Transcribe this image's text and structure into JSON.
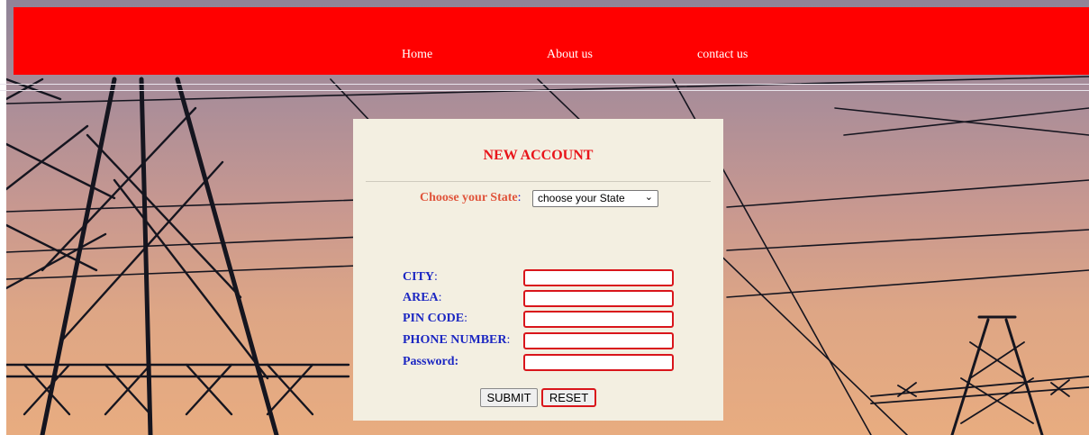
{
  "nav": {
    "items": [
      "Home",
      "About us",
      "contact us"
    ]
  },
  "form": {
    "title": "NEW ACCOUNT",
    "state": {
      "label": "Choose your State",
      "colon": ":",
      "selected": "choose your State"
    },
    "fields": [
      {
        "label": "CITY",
        "colon": ":",
        "value": ""
      },
      {
        "label": "AREA",
        "colon": ":",
        "value": ""
      },
      {
        "label": "PIN CODE",
        "colon": ":",
        "value": ""
      },
      {
        "label": "PHONE NUMBER",
        "colon": ":",
        "value": ""
      },
      {
        "label": "Password:",
        "colon": "",
        "value": ""
      }
    ],
    "submit_label": "SUBMIT",
    "reset_label": "RESET"
  },
  "colors": {
    "navbar": "#ff0000",
    "title": "#e8141a",
    "field_label": "#1c27c2",
    "state_label": "#e0553c",
    "input_border": "#d9151b",
    "panel_bg": "#f3efe1"
  }
}
